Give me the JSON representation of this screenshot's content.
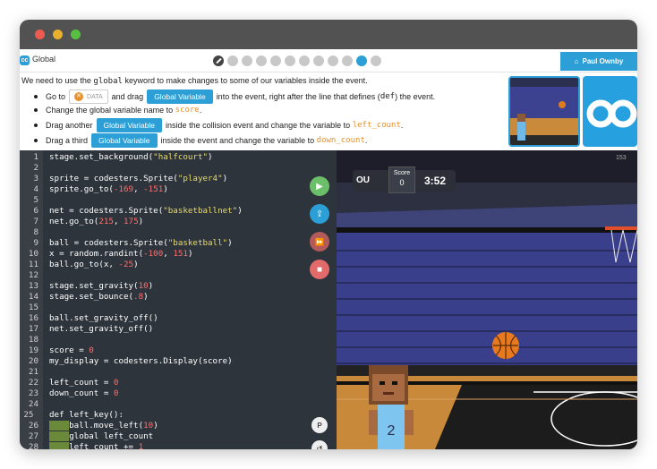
{
  "app": {
    "title": "Global",
    "user": "Paul Ownby"
  },
  "progress": {
    "total": 12,
    "active_index": 10
  },
  "colors": {
    "accent": "#2b9fd6",
    "orange": "#e8912c",
    "editor_bg": "#2e343b",
    "green": "#6cbf6a",
    "red": "#e36a6a"
  },
  "instructions": {
    "intro_before": "We need to use the",
    "intro_kw": "global",
    "intro_after": "keyword to make changes to some of our variables inside the event.",
    "step1": {
      "go_to": "Go to",
      "data_label": "DATA",
      "and_drag": "and drag",
      "button": "Global Variable",
      "rest": "into the event, right after the line that defines (",
      "def": "def",
      "rest2": ") the event."
    },
    "step2": {
      "text": "Change the global variable name to",
      "value": "score",
      "end": "."
    },
    "step3": {
      "text": "Drag another",
      "button": "Global Variable",
      "rest": "inside the collision event and change the variable to",
      "value": "left_count",
      "end": "."
    },
    "step4": {
      "text": "Drag a third",
      "button": "Global Variable",
      "rest": "inside the event and change the variable to",
      "value": "down_count",
      "end": "."
    }
  },
  "code": [
    {
      "n": "1",
      "t": "stage.set_background(\"halfcourt\")"
    },
    {
      "n": "2",
      "t": ""
    },
    {
      "n": "3",
      "t": "sprite = codesters.Sprite(\"player4\")"
    },
    {
      "n": "4",
      "t": "sprite.go_to(-169, -151)"
    },
    {
      "n": "5",
      "t": ""
    },
    {
      "n": "6",
      "t": "net = codesters.Sprite(\"basketballnet\")"
    },
    {
      "n": "7",
      "t": "net.go_to(215, 175)"
    },
    {
      "n": "8",
      "t": ""
    },
    {
      "n": "9",
      "t": "ball = codesters.Sprite(\"basketball\")"
    },
    {
      "n": "10",
      "t": "x = random.randint(-100, 151)"
    },
    {
      "n": "11",
      "t": "ball.go_to(x, -25)"
    },
    {
      "n": "12",
      "t": ""
    },
    {
      "n": "13",
      "t": "stage.set_gravity(10)"
    },
    {
      "n": "14",
      "t": "stage.set_bounce(.8)"
    },
    {
      "n": "15",
      "t": ""
    },
    {
      "n": "16",
      "t": "ball.set_gravity_off()"
    },
    {
      "n": "17",
      "t": "net.set_gravity_off()"
    },
    {
      "n": "18",
      "t": ""
    },
    {
      "n": "19",
      "t": "score = 0"
    },
    {
      "n": "20",
      "t": "my_display = codesters.Display(score)"
    },
    {
      "n": "21",
      "t": ""
    },
    {
      "n": "22",
      "t": "left_count = 0"
    },
    {
      "n": "23",
      "t": "down_count = 0"
    },
    {
      "n": "24",
      "t": ""
    },
    {
      "n": "25",
      "t": "def left_key():"
    },
    {
      "n": "26",
      "t": "    ball.move_left(10)"
    },
    {
      "n": "27",
      "t": "    global left_count"
    },
    {
      "n": "28",
      "t": "    left_count += 1"
    }
  ],
  "toolbar": {
    "play_icon": "play-icon",
    "upload_icon": "upload-icon",
    "fast_icon": "fast-forward-icon",
    "stop_icon": "stop-icon",
    "p_label": "P",
    "undo_icon": "undo-icon"
  },
  "stage": {
    "scoreboard_left": "OU",
    "score_label": "Score",
    "score_value": "0",
    "clock": "3:52",
    "corner_label": "153",
    "jersey_number": "2"
  }
}
